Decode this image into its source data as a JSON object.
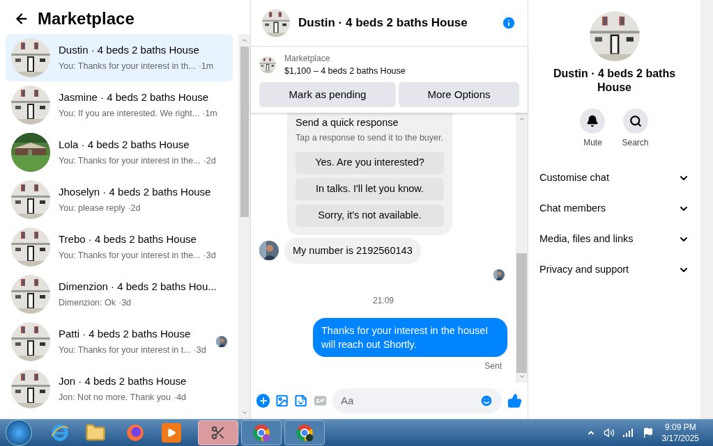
{
  "sidebar": {
    "title": "Marketplace",
    "conversations": [
      {
        "name": "Dustin · 4 beds 2 baths House",
        "preview": "You: Thanks for your interest in th...",
        "time": "·1m",
        "selected": true,
        "seen": false
      },
      {
        "name": "Jasmine · 4 beds 2 baths House",
        "preview": "You: If you are interested. We right...",
        "time": "·1m",
        "selected": false,
        "seen": false
      },
      {
        "name": "Lola · 4 beds 2 baths House",
        "preview": "You: Thanks for your interest in the...",
        "time": "·2d",
        "selected": false,
        "seen": false
      },
      {
        "name": "Jhoselyn · 4 beds 2 baths House",
        "preview": "You: please reply",
        "time": "·2d",
        "selected": false,
        "seen": false
      },
      {
        "name": "Trebo · 4 beds 2 baths House",
        "preview": "You: Thanks for your interest in the...",
        "time": "·3d",
        "selected": false,
        "seen": false
      },
      {
        "name": "Dimenzion · 4 beds 2 baths Hou...",
        "preview": "Dimenzion: Ok",
        "time": "·3d",
        "selected": false,
        "seen": false
      },
      {
        "name": "Patti · 4 beds 2 baths House",
        "preview": "You: Thanks for your interest in t...",
        "time": "·3d",
        "selected": false,
        "seen": true
      },
      {
        "name": "Jon · 4 beds 2 baths House",
        "preview": "Jon: Not no more. Thank you",
        "time": "·4d",
        "selected": false,
        "seen": false
      }
    ]
  },
  "chat": {
    "title": "Dustin · 4 beds 2 baths House",
    "listing": {
      "label": "Marketplace",
      "price": "$1,100 – 4 beds 2 baths House",
      "buttons": [
        "Mark as pending",
        "More Options"
      ]
    },
    "messages": [
      {
        "kind": "quick_response",
        "title": "Send a quick response",
        "subtitle": "Tap a response to send it to the buyer.",
        "options": [
          "Yes. Are you interested?",
          "In talks. I'll let you know.",
          "Sorry, it's not available."
        ]
      },
      {
        "kind": "incoming",
        "text": "My number is 2192560143"
      },
      {
        "kind": "seen"
      },
      {
        "kind": "timestamp",
        "text": "21:09"
      },
      {
        "kind": "outgoing",
        "text": "Thanks for your interest in the houseI will reach out Shortly.",
        "status": "Sent"
      }
    ],
    "composer": {
      "placeholder": "Aa"
    }
  },
  "details": {
    "title": "Dustin · 4 beds 2 baths House",
    "actions": [
      {
        "kind": "mute",
        "label": "Mute"
      },
      {
        "kind": "search",
        "label": "Search"
      }
    ],
    "sections": [
      {
        "label": "Customise chat",
        "expanded": false
      },
      {
        "label": "Chat members",
        "expanded": false
      },
      {
        "label": "Media, files and links",
        "expanded": false
      },
      {
        "label": "Privacy and support",
        "expanded": false
      }
    ]
  },
  "taskbar": {
    "time": "9:09 PM",
    "date": "3/17/2025"
  }
}
